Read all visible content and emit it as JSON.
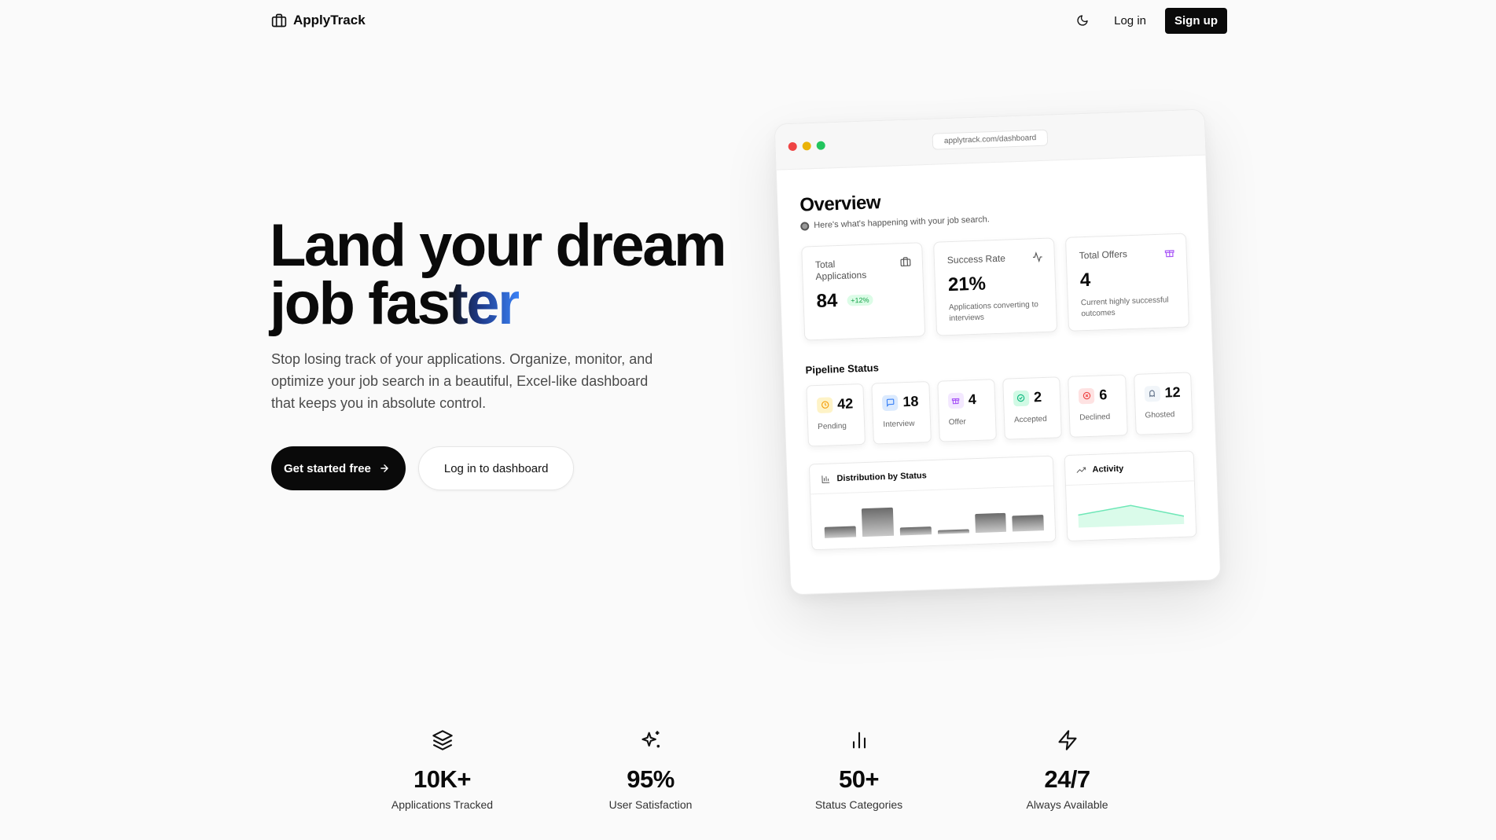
{
  "nav": {
    "brand": "ApplyTrack",
    "login": "Log in",
    "signup": "Sign up",
    "theme_icon": "moon-icon"
  },
  "hero": {
    "title_line1": "Land your dream",
    "title_line2_plain": "job fas",
    "title_line2_grad": "ter",
    "description": "Stop losing track of your applications. Organize, monitor, and optimize your job search in a beautiful, Excel-like dashboard that keeps you in absolute control.",
    "cta_primary": "Get started free",
    "cta_secondary": "Log in to dashboard"
  },
  "mock": {
    "url": "applytrack.com/dashboard",
    "overview_title": "Overview",
    "overview_sub": "Here's what's happening with your job search.",
    "stats": [
      {
        "label": "Total Applications",
        "value": "84",
        "badge": "+12%",
        "icon": "briefcase-icon"
      },
      {
        "label": "Success Rate",
        "value": "21%",
        "desc": "Applications converting to interviews",
        "icon": "activity-icon"
      },
      {
        "label": "Total Offers",
        "value": "4",
        "desc": "Current highly successful outcomes",
        "icon": "gift-icon"
      }
    ],
    "pipeline_title": "Pipeline Status",
    "pipeline": [
      {
        "value": "42",
        "label": "Pending",
        "color": "#f59e0b",
        "bg": "#fef3c7",
        "icon": "clock-icon"
      },
      {
        "value": "18",
        "label": "Interview",
        "color": "#3b82f6",
        "bg": "#dbeafe",
        "icon": "message-icon"
      },
      {
        "value": "4",
        "label": "Offer",
        "color": "#a855f7",
        "bg": "#f3e8ff",
        "icon": "gift-icon"
      },
      {
        "value": "2",
        "label": "Accepted",
        "color": "#10b981",
        "bg": "#d1fae5",
        "icon": "check-circle-icon"
      },
      {
        "value": "6",
        "label": "Declined",
        "color": "#ef4444",
        "bg": "#fee2e2",
        "icon": "x-circle-icon"
      },
      {
        "value": "12",
        "label": "Ghosted",
        "color": "#64748b",
        "bg": "#f1f5f9",
        "icon": "ghost-icon"
      }
    ],
    "distribution_title": "Distribution by Status",
    "activity_title": "Activity"
  },
  "stats": [
    {
      "value": "10K+",
      "label": "Applications Tracked",
      "icon": "layers-icon"
    },
    {
      "value": "95%",
      "label": "User Satisfaction",
      "icon": "sparkles-icon"
    },
    {
      "value": "50+",
      "label": "Status Categories",
      "icon": "bar-chart-icon"
    },
    {
      "value": "24/7",
      "label": "Always Available",
      "icon": "zap-icon"
    }
  ]
}
